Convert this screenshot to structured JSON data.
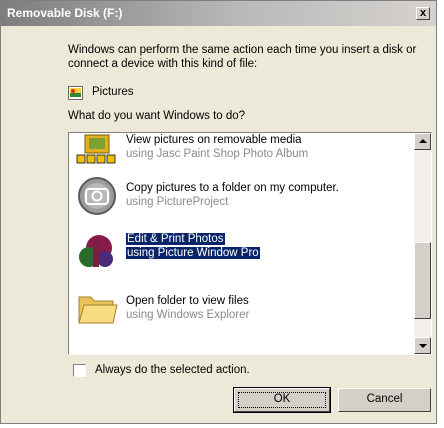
{
  "window": {
    "title": "Removable Disk (F:)",
    "close_symbol": "x"
  },
  "description": "Windows can perform the same action each time you insert a disk or connect a device with this kind of file:",
  "content_type": {
    "icon": "pictures-icon",
    "label": "Pictures"
  },
  "question": "What do you want Windows to do?",
  "actions": [
    {
      "title": "View pictures on removable media",
      "subtitle": "using Jasc Paint Shop Photo Album",
      "icon": "photo-album-icon",
      "selected": false
    },
    {
      "title": "Copy pictures to a folder on my computer.",
      "subtitle": "using PictureProject",
      "icon": "camera-icon",
      "selected": false
    },
    {
      "title": "Edit & Print Photos",
      "subtitle": "using Picture Window Pro",
      "icon": "picture-window-pro-icon",
      "selected": true
    },
    {
      "title": "Open folder to view files",
      "subtitle": "using Windows Explorer",
      "icon": "folder-icon",
      "selected": false
    }
  ],
  "always_checkbox": {
    "label": "Always do the selected action.",
    "checked": false
  },
  "buttons": {
    "ok": "OK",
    "cancel": "Cancel"
  },
  "colors": {
    "selection": "#0a246a",
    "dialog_bg": "#ece9d8",
    "title_bar": "#7d7d7d"
  }
}
